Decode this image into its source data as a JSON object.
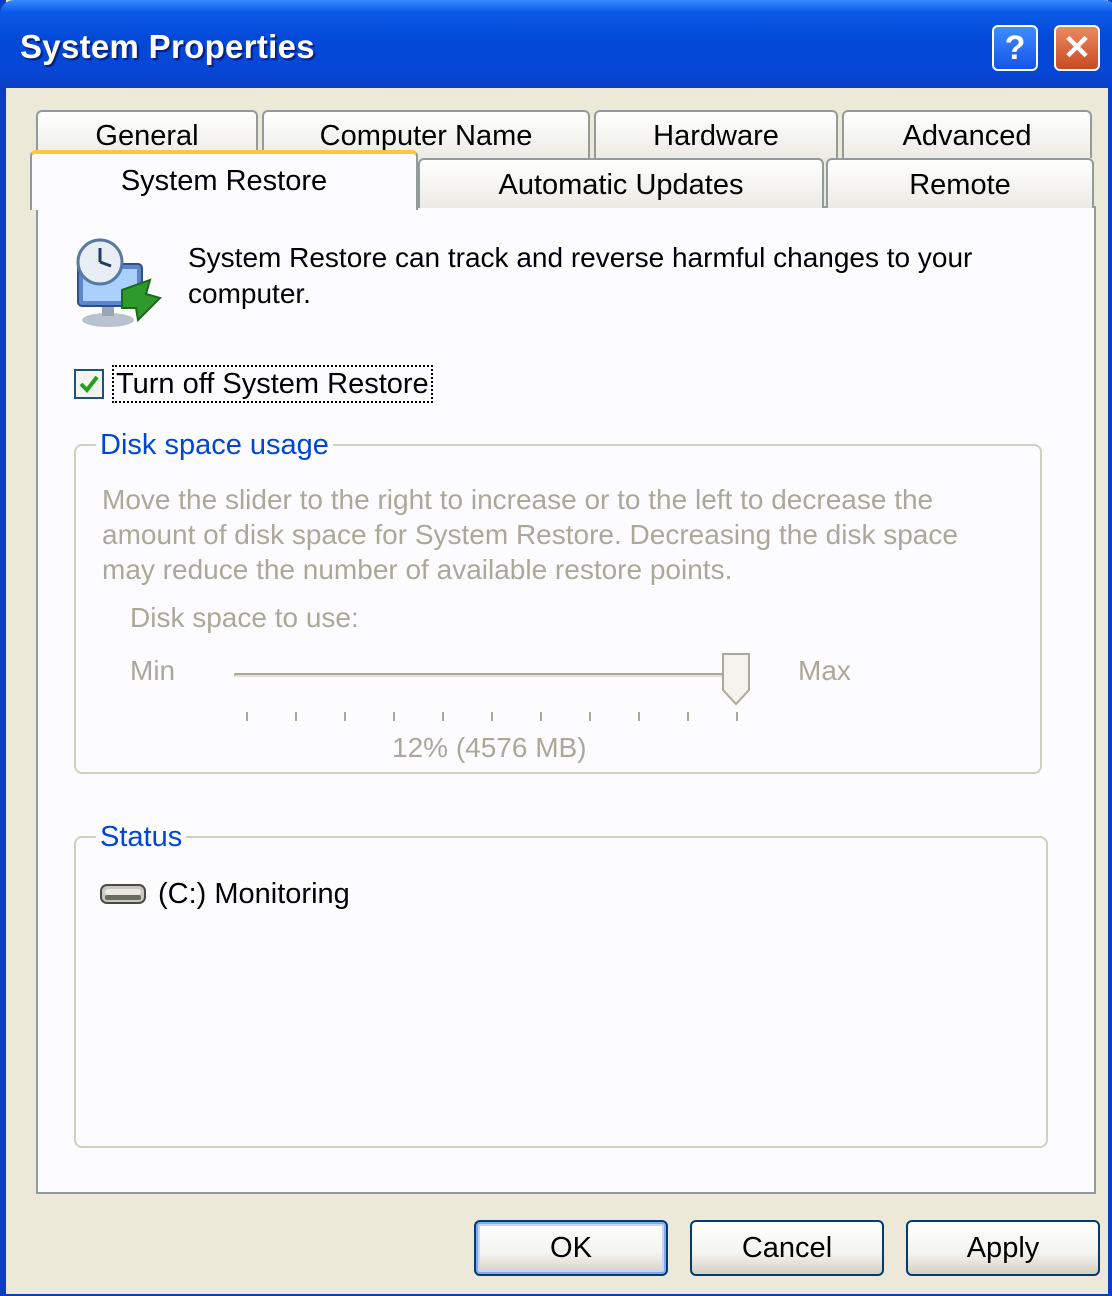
{
  "window": {
    "title": "System Properties"
  },
  "titlebar_buttons": {
    "help": "?",
    "close": "✕"
  },
  "tabs": {
    "row1": [
      "General",
      "Computer Name",
      "Hardware",
      "Advanced"
    ],
    "row2": [
      "System Restore",
      "Automatic Updates",
      "Remote"
    ],
    "active": "System Restore"
  },
  "intro": {
    "text": "System Restore can track and reverse harmful changes to your computer.",
    "icon": "system-restore-icon"
  },
  "turn_off": {
    "label": "Turn off System Restore",
    "checked": true
  },
  "disk_usage": {
    "group_title": "Disk space usage",
    "description": "Move the slider to the right to increase or to the left to decrease the amount of disk space for System Restore. Decreasing the disk space may reduce the number of available restore points.",
    "slider_label": "Disk space to use:",
    "min_label": "Min",
    "max_label": "Max",
    "slider_value_fraction": 1.0,
    "value_text": "12% (4576 MB)"
  },
  "status": {
    "group_title": "Status",
    "drives": [
      {
        "text": "(C:) Monitoring",
        "icon": "hard-drive-icon"
      }
    ]
  },
  "buttons": {
    "ok": "OK",
    "cancel": "Cancel",
    "apply": "Apply"
  },
  "colors": {
    "titlebar": "#0a5ae6",
    "group_title": "#0046d5",
    "active_tab_accent": "#ffc83c",
    "checkbox_tick": "#21a121"
  }
}
